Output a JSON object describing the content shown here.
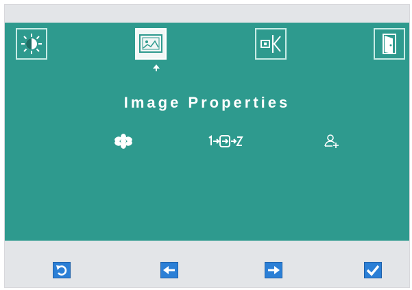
{
  "osd": {
    "tabs": [
      {
        "icon": "brightness-icon",
        "selected": false
      },
      {
        "icon": "image-properties-icon",
        "selected": true
      },
      {
        "icon": "input-source-icon",
        "selected": false
      },
      {
        "icon": "exit-icon",
        "selected": false
      }
    ],
    "title": "Image Properties",
    "sub_icons": [
      "snowflake-icon",
      "signal-conversion-icon",
      "user-settings-icon"
    ]
  },
  "buttons": [
    {
      "icon": "undo-icon"
    },
    {
      "icon": "arrow-left-icon"
    },
    {
      "icon": "arrow-right-icon"
    },
    {
      "icon": "checkmark-icon"
    }
  ],
  "colors": {
    "osd_background": "#2e9a8e",
    "button_blue": "#2b7fd6",
    "title_text": "#ffffff"
  }
}
